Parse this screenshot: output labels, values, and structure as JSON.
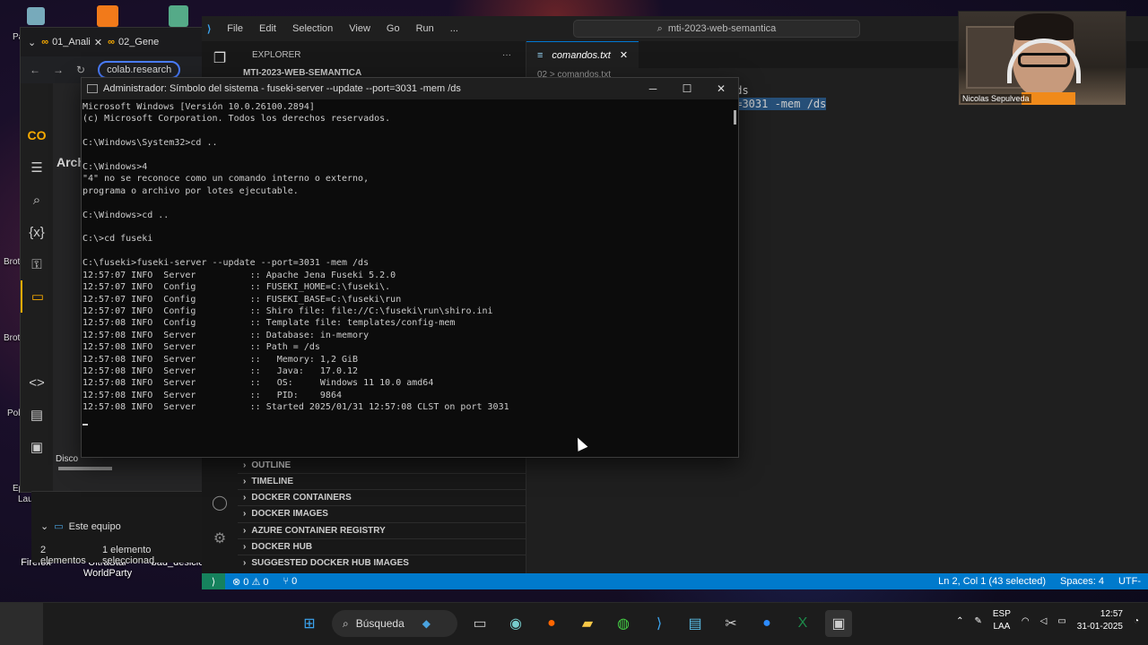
{
  "desktop": {
    "icons": [
      {
        "label": "Firefox"
      },
      {
        "label": "UltraStar WorldParty"
      },
      {
        "label": "bad_desicio"
      }
    ],
    "side_labels": [
      "Pa",
      "Brot",
      "Brot",
      "Pol",
      "Ep",
      "Lau"
    ]
  },
  "browser": {
    "tabs": [
      "01_Anali",
      "02_Gene"
    ],
    "url": "colab.research",
    "sidebar_header": "Archi",
    "disk_label": "Disco",
    "logo": "CO"
  },
  "file_explorer": {
    "tree_item": "Este equipo",
    "status_count": "2 elementos",
    "status_selected": "1 elemento seleccionad"
  },
  "vscode": {
    "menu": [
      "File",
      "Edit",
      "Selection",
      "View",
      "Go",
      "Run",
      "..."
    ],
    "command_center": "mti-2023-web-semantica",
    "explorer_title": "EXPLORER",
    "explorer_root": "MTI-2023-WEB-SEMANTICA",
    "sections": [
      "OUTLINE",
      "TIMELINE",
      "DOCKER CONTAINERS",
      "DOCKER IMAGES",
      "AZURE CONTAINER REGISTRY",
      "DOCKER HUB",
      "SUGGESTED DOCKER HUB IMAGES"
    ],
    "tab_name": "comandos.txt",
    "breadcrumb": "02 > comandos.txt",
    "code_line1": "/ds",
    "code_line2": "t=3031 -mem /ds",
    "status": {
      "problems": "⊗ 0 ⚠ 0",
      "ports": "⑂ 0",
      "cursor": "Ln 2, Col 1 (43 selected)",
      "spaces": "Spaces: 4",
      "encoding": "UTF-"
    }
  },
  "webcam": {
    "name": "Nicolas Sepulveda"
  },
  "cmd": {
    "title": "Administrador: Símbolo del sistema - fuseki-server  --update --port=3031 -mem /ds",
    "lines": [
      "Microsoft Windows [Versión 10.0.26100.2894]",
      "(c) Microsoft Corporation. Todos los derechos reservados.",
      "",
      "C:\\Windows\\System32>cd ..",
      "",
      "C:\\Windows>4",
      "\"4\" no se reconoce como un comando interno o externo,",
      "programa o archivo por lotes ejecutable.",
      "",
      "C:\\Windows>cd ..",
      "",
      "C:\\>cd fuseki",
      "",
      "C:\\fuseki>fuseki-server --update --port=3031 -mem /ds",
      "12:57:07 INFO  Server          :: Apache Jena Fuseki 5.2.0",
      "12:57:07 INFO  Config          :: FUSEKI_HOME=C:\\fuseki\\.",
      "12:57:07 INFO  Config          :: FUSEKI_BASE=C:\\fuseki\\run",
      "12:57:07 INFO  Config          :: Shiro file: file://C:\\fuseki\\run\\shiro.ini",
      "12:57:08 INFO  Config          :: Template file: templates/config-mem",
      "12:57:08 INFO  Server          :: Database: in-memory",
      "12:57:08 INFO  Server          :: Path = /ds",
      "12:57:08 INFO  Server          ::   Memory: 1,2 GiB",
      "12:57:08 INFO  Server          ::   Java:   17.0.12",
      "12:57:08 INFO  Server          ::   OS:     Windows 11 10.0 amd64",
      "12:57:08 INFO  Server          ::   PID:    9864",
      "12:57:08 INFO  Server          :: Started 2025/01/31 12:57:08 CLST on port 3031"
    ]
  },
  "taskbar": {
    "search_placeholder": "Búsqueda",
    "lang_top": "ESP",
    "lang_bottom": "LAA",
    "time": "12:57",
    "date": "31-01-2025"
  }
}
